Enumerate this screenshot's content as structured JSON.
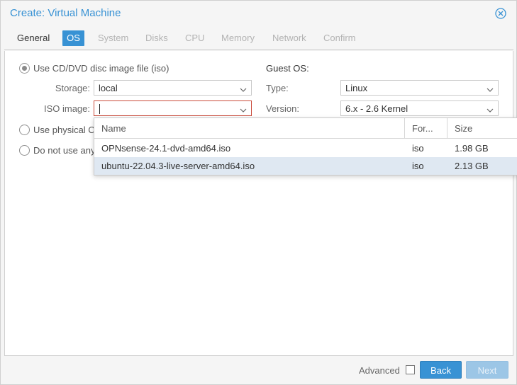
{
  "dialog": {
    "title": "Create: Virtual Machine"
  },
  "tabs": [
    {
      "label": "General",
      "state": "enabled"
    },
    {
      "label": "OS",
      "state": "active"
    },
    {
      "label": "System",
      "state": "disabled"
    },
    {
      "label": "Disks",
      "state": "disabled"
    },
    {
      "label": "CPU",
      "state": "disabled"
    },
    {
      "label": "Memory",
      "state": "disabled"
    },
    {
      "label": "Network",
      "state": "disabled"
    },
    {
      "label": "Confirm",
      "state": "disabled"
    }
  ],
  "media": {
    "option_iso": "Use CD/DVD disc image file (iso)",
    "option_physical": "Use physical C",
    "option_none": "Do not use any",
    "storage_label": "Storage:",
    "storage_value": "local",
    "iso_label": "ISO image:",
    "iso_value": ""
  },
  "guest_os": {
    "title": "Guest OS:",
    "type_label": "Type:",
    "type_value": "Linux",
    "version_label": "Version:",
    "version_value": "6.x - 2.6 Kernel"
  },
  "iso_dropdown": {
    "columns": [
      "Name",
      "For...",
      "Size"
    ],
    "rows": [
      {
        "name": "OPNsense-24.1-dvd-amd64.iso",
        "format": "iso",
        "size": "1.98 GB",
        "selected": false
      },
      {
        "name": "ubuntu-22.04.3-live-server-amd64.iso",
        "format": "iso",
        "size": "2.13 GB",
        "selected": true
      }
    ]
  },
  "footer": {
    "advanced_label": "Advanced",
    "back_label": "Back",
    "next_label": "Next"
  },
  "colors": {
    "accent": "#3892d4",
    "invalid_border": "#c94a3a",
    "selected_row": "#dfe8f2"
  }
}
